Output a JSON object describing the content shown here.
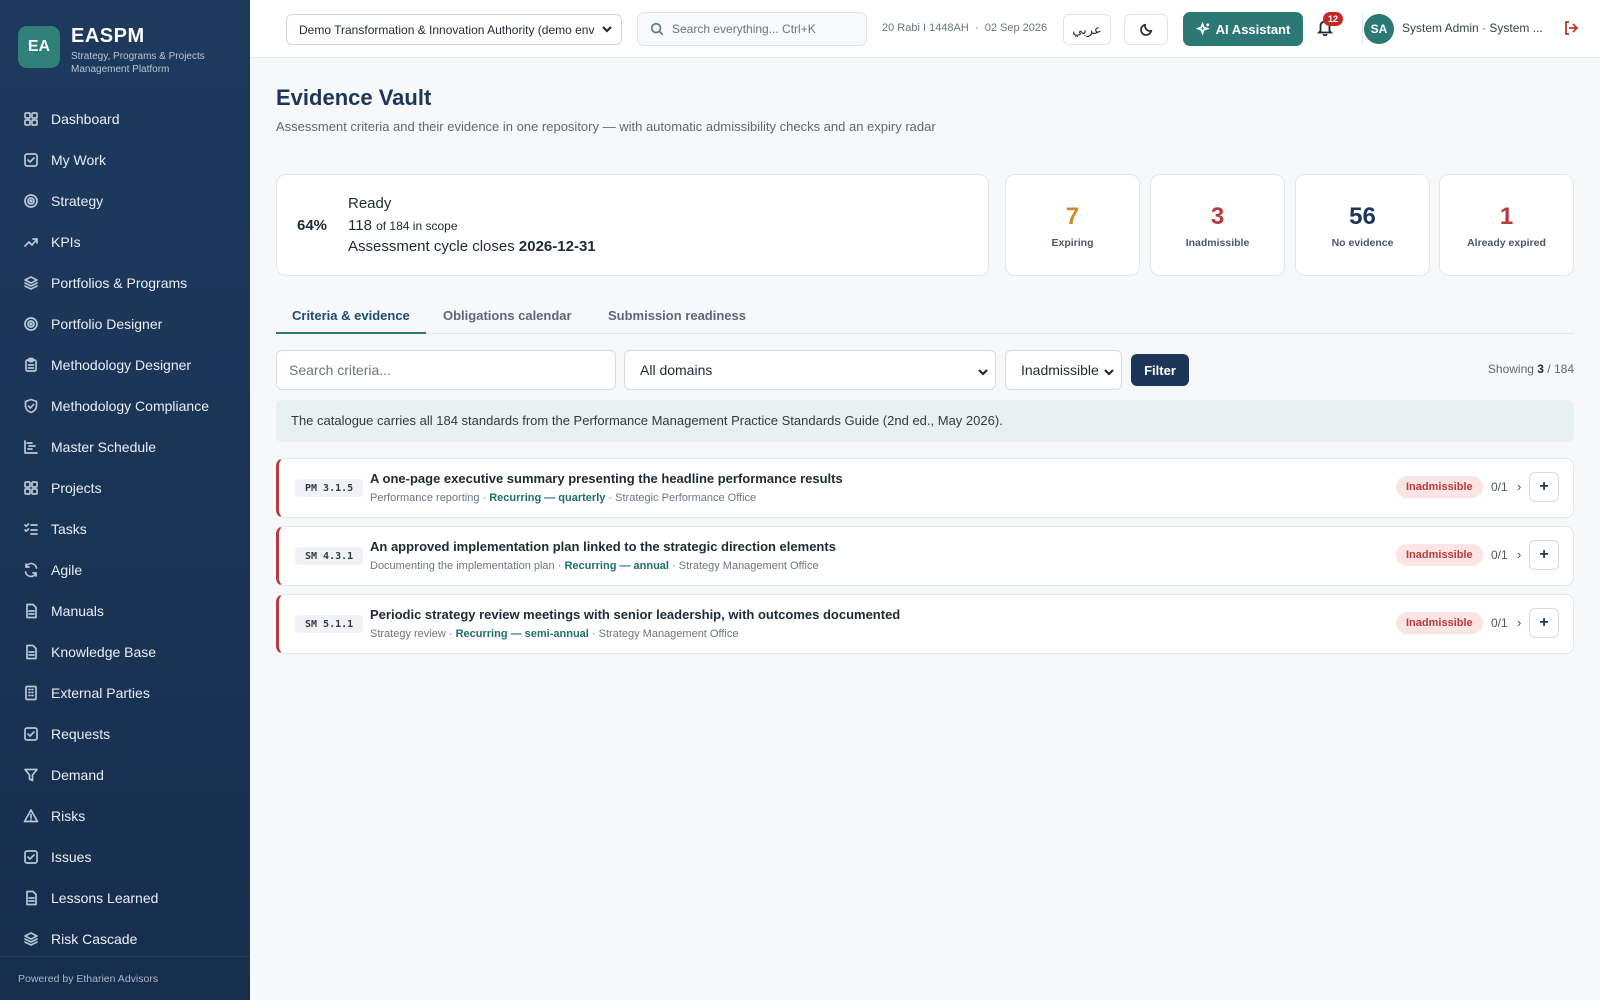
{
  "brand": {
    "badge": "EA",
    "name": "EASPM",
    "subtitle": "Strategy, Programs & Projects Management Platform"
  },
  "sidebar": {
    "items": [
      {
        "label": "Dashboard",
        "icon": "grid-icon"
      },
      {
        "label": "My Work",
        "icon": "check-square-icon"
      },
      {
        "label": "Strategy",
        "icon": "target-icon"
      },
      {
        "label": "KPIs",
        "icon": "trend-up-icon"
      },
      {
        "label": "Portfolios & Programs",
        "icon": "layers-icon"
      },
      {
        "label": "Portfolio Designer",
        "icon": "target-icon"
      },
      {
        "label": "Methodology Designer",
        "icon": "clipboard-icon"
      },
      {
        "label": "Methodology Compliance",
        "icon": "shield-check-icon"
      },
      {
        "label": "Master Schedule",
        "icon": "gantt-icon"
      },
      {
        "label": "Projects",
        "icon": "grid-icon"
      },
      {
        "label": "Tasks",
        "icon": "list-check-icon"
      },
      {
        "label": "Agile",
        "icon": "refresh-icon"
      },
      {
        "label": "Manuals",
        "icon": "document-icon"
      },
      {
        "label": "Knowledge Base",
        "icon": "document-icon"
      },
      {
        "label": "External Parties",
        "icon": "building-icon"
      },
      {
        "label": "Requests",
        "icon": "check-square-icon"
      },
      {
        "label": "Demand",
        "icon": "funnel-icon"
      },
      {
        "label": "Risks",
        "icon": "warning-icon"
      },
      {
        "label": "Issues",
        "icon": "check-square-icon"
      },
      {
        "label": "Lessons Learned",
        "icon": "document-icon"
      },
      {
        "label": "Risk Cascade",
        "icon": "layers-icon"
      }
    ],
    "footer": "Powered by Etharien Advisors"
  },
  "header": {
    "org_select": "Demo Transformation & Innovation Authority (demo env",
    "search_placeholder": "Search everything... Ctrl+K",
    "hijri_date": "20 Rabi I 1448AH",
    "separator": "·",
    "gregorian_date": "02 Sep 2026",
    "lang_button": "عربي",
    "ai_button": "AI Assistant",
    "notifications_count": "12",
    "avatar_initials": "SA",
    "user_name": "System Admin · System ..."
  },
  "page": {
    "title": "Evidence Vault",
    "subtitle": "Assessment criteria and their evidence in one repository — with automatic admissibility checks and an expiry radar"
  },
  "readiness": {
    "percent": "64%",
    "label": "Ready",
    "ready_count": "118",
    "of_text": "of 184 in scope",
    "cycle_text": "Assessment cycle closes",
    "cycle_date": "2026-12-31"
  },
  "kpis": [
    {
      "value": "7",
      "label": "Expiring",
      "color": "#d08a2a"
    },
    {
      "value": "3",
      "label": "Inadmissible",
      "color": "#b83a3a"
    },
    {
      "value": "56",
      "label": "No evidence",
      "color": "#1d3557"
    },
    {
      "value": "1",
      "label": "Already expired",
      "color": "#b83a3a"
    }
  ],
  "tabs": [
    {
      "label": "Criteria & evidence",
      "active": true
    },
    {
      "label": "Obligations calendar",
      "active": false
    },
    {
      "label": "Submission readiness",
      "active": false
    }
  ],
  "filters": {
    "search_placeholder": "Search criteria...",
    "domain_value": "All domains",
    "status_value": "Inadmissible",
    "filter_button": "Filter",
    "showing_label": "Showing",
    "showing_count": "3",
    "showing_total": "/ 184"
  },
  "notice": "The catalogue carries all 184 standards from the Performance Management Practice Standards Guide (2nd ed., May 2026).",
  "criteria": [
    {
      "code": "PM 3.1.5",
      "title": "A one-page executive summary presenting the headline performance results",
      "category": "Performance reporting",
      "recurrence": "Recurring — quarterly",
      "owner": "Strategic Performance Office",
      "status": "Inadmissible",
      "count": "0/1"
    },
    {
      "code": "SM 4.3.1",
      "title": "An approved implementation plan linked to the strategic direction elements",
      "category": "Documenting the implementation plan",
      "recurrence": "Recurring — annual",
      "owner": "Strategy Management Office",
      "status": "Inadmissible",
      "count": "0/1"
    },
    {
      "code": "SM 5.1.1",
      "title": "Periodic strategy review meetings with senior leadership, with outcomes documented",
      "category": "Strategy review",
      "recurrence": "Recurring — semi-annual",
      "owner": "Strategy Management Office",
      "status": "Inadmissible",
      "count": "0/1"
    }
  ]
}
